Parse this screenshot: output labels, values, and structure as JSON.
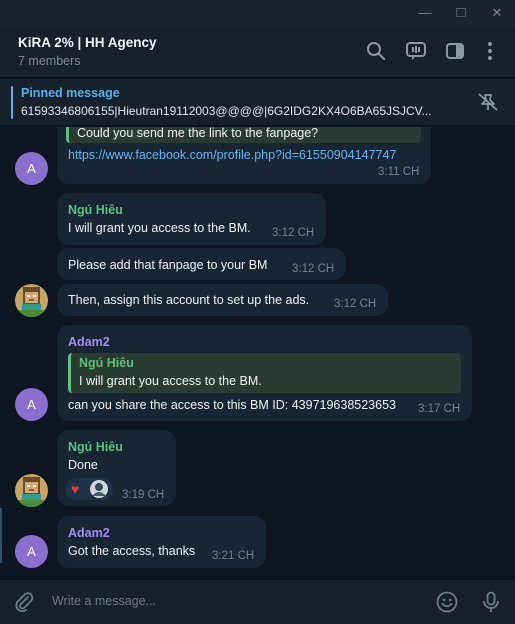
{
  "window": {
    "minimize_glyph": "—",
    "maximize_glyph": "□",
    "close_glyph": "✕"
  },
  "header": {
    "title": "KiRA 2% | HH Agency",
    "subtitle": "7 members",
    "icons": [
      "search-icon",
      "video-chat-icon",
      "sidebar-toggle-icon",
      "more-menu-icon"
    ]
  },
  "pinned": {
    "title": "Pinned message",
    "text": "61593346806155|Hieutran19112003@@@@|6G2IDG2KX4O6BA65JSJCV..."
  },
  "messages": {
    "m1": {
      "quote_text": "Could you send me the link to the fanpage?",
      "link": "https://www.facebook.com/profile.php?id=61550904147747",
      "time": "3:11 CH",
      "avatar_letter": "A"
    },
    "m2": {
      "sender": "Ngú Hiêu",
      "text": "I will grant you access to the BM.",
      "time": "3:12 CH"
    },
    "m3": {
      "text": "Please add that fanpage to your BM",
      "time": "3:12 CH"
    },
    "m4": {
      "text": "Then, assign this account to set up the ads.",
      "time": "3:12 CH"
    },
    "m5": {
      "sender": "Adam2",
      "quote_sender": "Ngú Hiêu",
      "quote_text": "I will grant you access to the BM.",
      "text": "can you share the access to this BM ID: 439719638523653",
      "time": "3:17 CH",
      "avatar_letter": "A"
    },
    "m6": {
      "sender": "Ngú Hiêu",
      "text": "Done",
      "time": "3:19 CH",
      "reaction_emoji": "♥"
    },
    "m7": {
      "sender": "Adam2",
      "text": "Got the access, thanks",
      "time": "3:21 CH",
      "avatar_letter": "A"
    }
  },
  "composer": {
    "placeholder": "Write a message..."
  },
  "colors": {
    "background": "#0e1621",
    "bubble": "#182533",
    "sender_green": "#5fc07e",
    "sender_purple": "#a58cf0",
    "link": "#6ab3f3",
    "accent": "#5eaee8"
  }
}
